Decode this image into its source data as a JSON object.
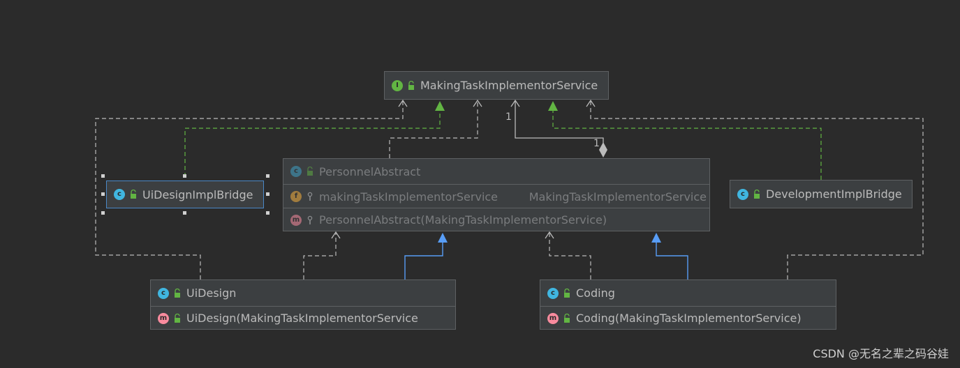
{
  "nodes": {
    "interface": {
      "name": "MakingTaskImplementorService",
      "badge": "I"
    },
    "ui_bridge": {
      "name": "UiDesignImplBridge",
      "badge": "c"
    },
    "dev_bridge": {
      "name": "DevelopmentImplBridge",
      "badge": "c"
    },
    "abstract": {
      "name": "PersonnelAbstract",
      "badge": "c",
      "field": {
        "badge": "f",
        "name": "makingTaskImplementorService",
        "type": "MakingTaskImplementorService"
      },
      "method": {
        "badge": "m",
        "name": "PersonnelAbstract(MakingTaskImplementorService)"
      }
    },
    "uidesign": {
      "name": "UiDesign",
      "badge": "c",
      "method": {
        "badge": "m",
        "name": "UiDesign(MakingTaskImplementorService"
      }
    },
    "coding": {
      "name": "Coding",
      "badge": "c",
      "method": {
        "badge": "m",
        "name": "Coding(MakingTaskImplementorService)"
      }
    }
  },
  "multiplicity": {
    "source": "1",
    "target": "1"
  },
  "watermark": "CSDN @无名之辈之码谷娃",
  "colors": {
    "background": "#2b2b2b",
    "node": "#3c3f41",
    "implements": "#62b543",
    "extends": "#589df6",
    "dependency": "#bbbbbb"
  }
}
